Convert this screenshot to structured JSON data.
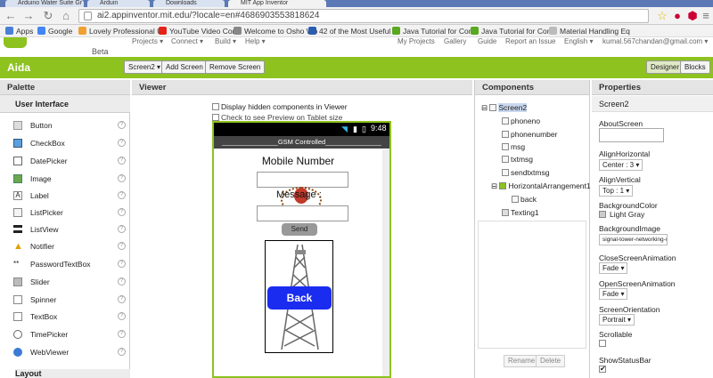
{
  "browser": {
    "tabs": [
      "Arduino Water Suite Gr",
      "Arduin",
      "Downloads",
      "MIT App Inventor"
    ],
    "url": "ai2.appinventor.mit.edu/?locale=en#4686903553818624",
    "bookmarks": [
      "Apps",
      "Google",
      "Lovely Professional U",
      "YouTube Video Conv",
      "Welcome to Osho Wo",
      "42 of the Most Useful",
      "Java Tutorial for Com",
      "Java Tutorial for Com",
      "Material Handling Eq"
    ]
  },
  "topbar": {
    "beta": "Beta",
    "menus": [
      "Projects ▾",
      "Connect ▾",
      "Build ▾",
      "Help ▾"
    ],
    "right_menus": [
      "My Projects",
      "Gallery",
      "Guide",
      "Report an Issue",
      "English ▾",
      "kumal.567chandan@gmail.com ▾"
    ]
  },
  "designer_bar": {
    "project_name": "Aida",
    "screen_select": "Screen2 ▾",
    "add_screen": "Add Screen ...",
    "remove_screen": "Remove Screen",
    "designer": "Designer",
    "blocks": "Blocks"
  },
  "palette": {
    "title": "Palette",
    "section": "User Interface",
    "items": [
      "Button",
      "CheckBox",
      "DatePicker",
      "Image",
      "Label",
      "ListPicker",
      "ListView",
      "Notifier",
      "PasswordTextBox",
      "Slider",
      "Spinner",
      "TextBox",
      "TimePicker",
      "WebViewer"
    ],
    "next_section": "Layout"
  },
  "viewer": {
    "title": "Viewer",
    "display_hidden": "Display hidden components in Viewer",
    "tablet_preview": "Check to see Preview on Tablet size",
    "clock": "9:48",
    "screen_title": "_______________GSM Controlled_______________",
    "label_mobile": "Mobile Number",
    "label_message": "Message :",
    "send_button": "Send",
    "back_button": "Back"
  },
  "components": {
    "title": "Components",
    "tree": [
      "Screen2",
      "phoneno",
      "phonenumber",
      "msg",
      "txtmsg",
      "sendtxtmsg",
      "HorizontalArrangement1",
      "back",
      "Texting1"
    ],
    "rename": "Rename",
    "delete": "Delete"
  },
  "properties": {
    "title": "Properties",
    "screen": "Screen2",
    "about_label": "AboutScreen",
    "align_h_label": "AlignHorizontal",
    "align_h_value": "Center : 3 ▾",
    "align_v_label": "AlignVertical",
    "align_v_value": "Top : 1 ▾",
    "bgcolor_label": "BackgroundColor",
    "bgcolor_value": "Light Gray",
    "bgimage_label": "BackgroundImage",
    "bgimage_value": "signal-tower-networking-wi",
    "close_anim_label": "CloseScreenAnimation",
    "close_anim_value": "Fade ▾",
    "open_anim_label": "OpenScreenAnimation",
    "open_anim_value": "Fade ▾",
    "orientation_label": "ScreenOrientation",
    "orientation_value": "Portrait ▾",
    "scrollable_label": "Scrollable",
    "status_bar_label": "ShowStatusBar"
  }
}
